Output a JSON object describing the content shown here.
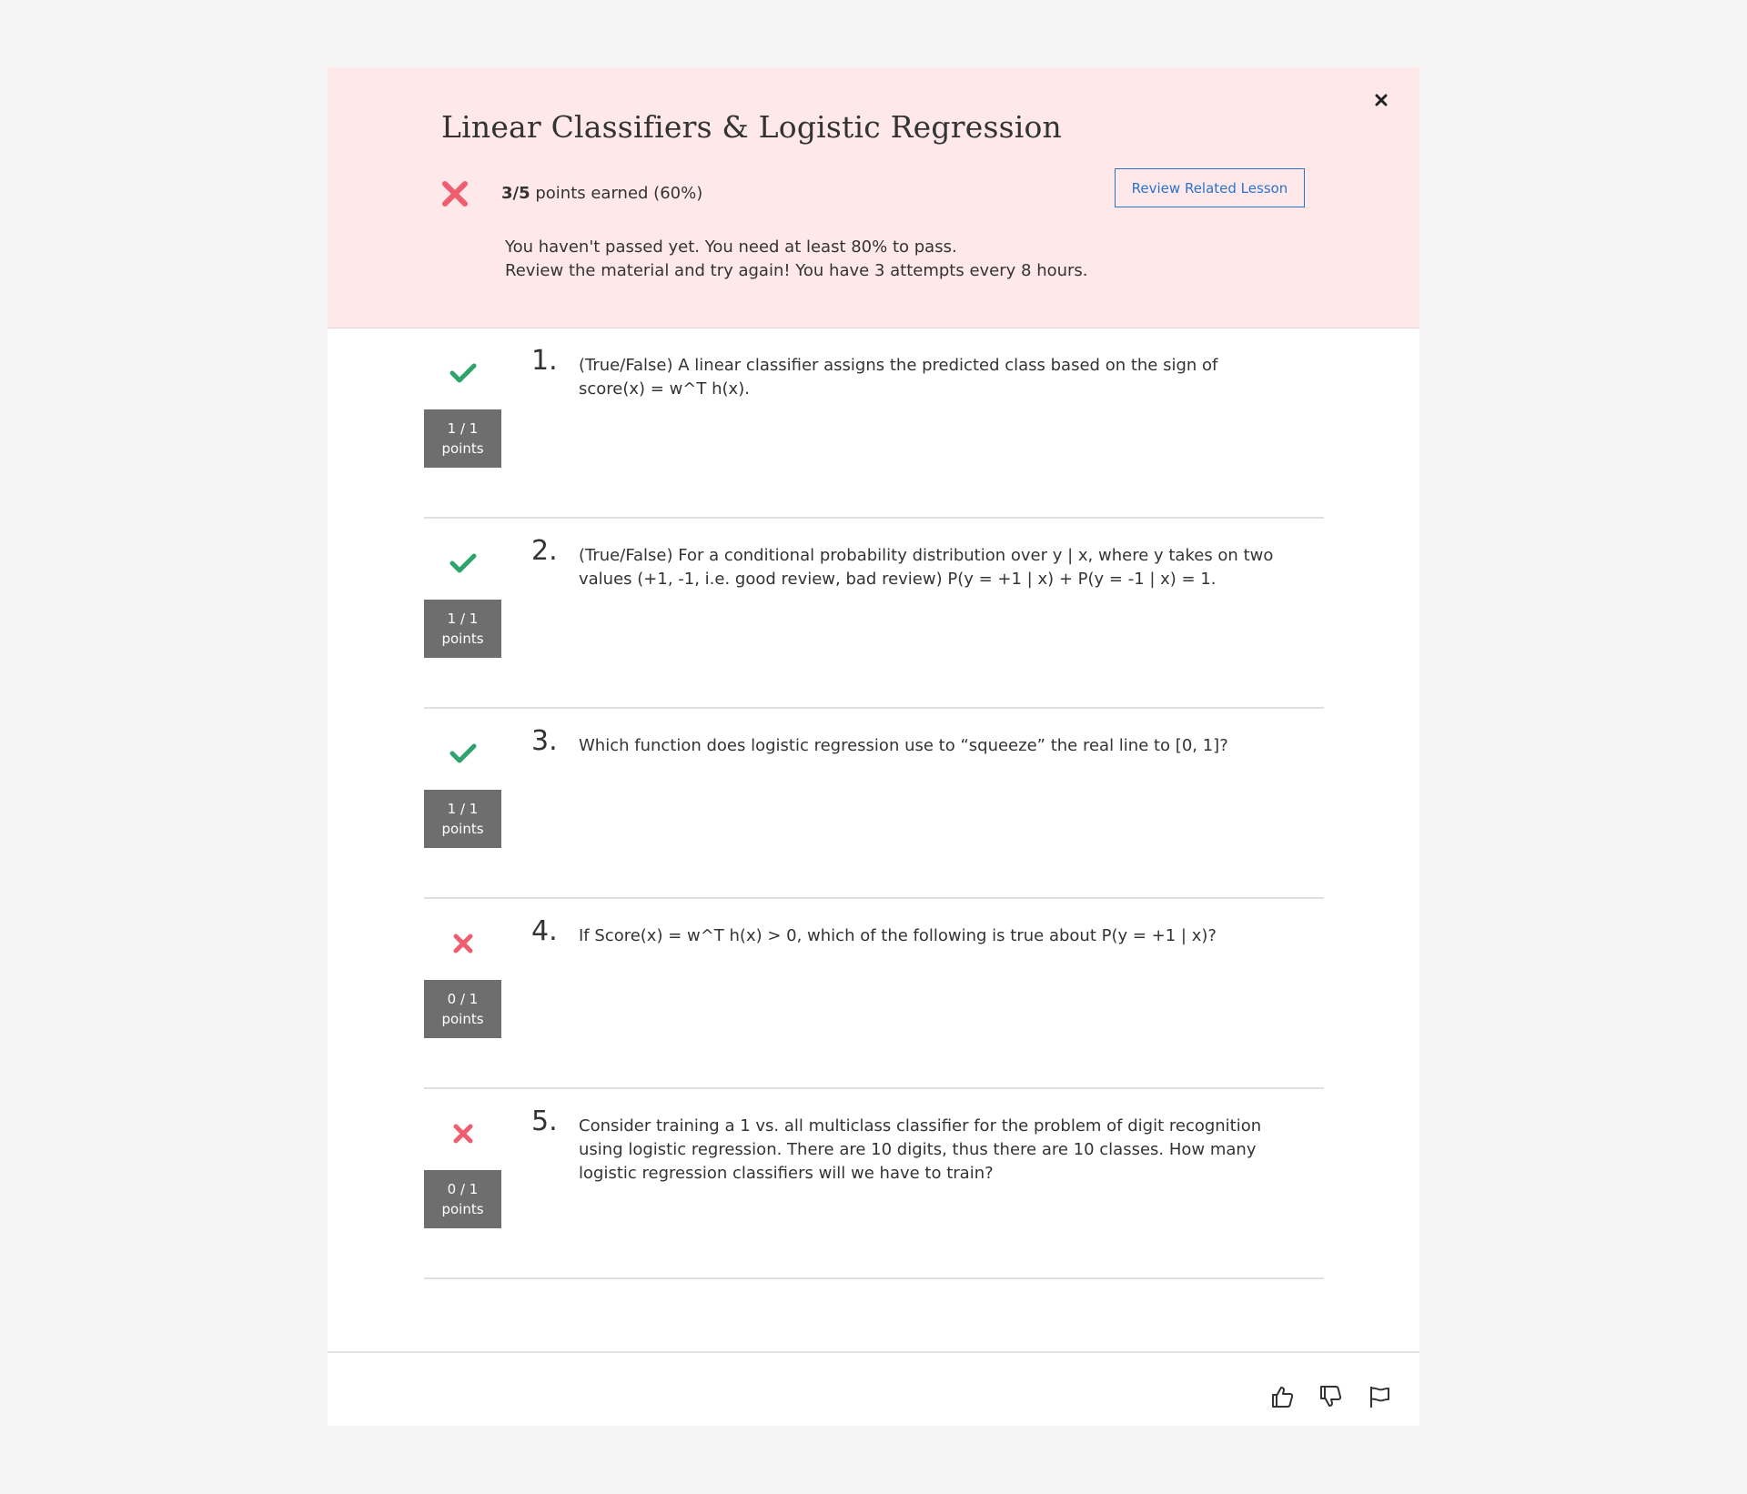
{
  "banner": {
    "title": "Linear Classifiers & Logistic Regression",
    "score_value": "3/5",
    "score_suffix": " points earned (60%)",
    "review_button_label": "Review Related Lesson",
    "message_line1": "You haven't passed yet. You need at least 80% to pass.",
    "message_line2": "Review the material and try again!  You have 3 attempts every 8 hours.",
    "close_icon": "close-icon",
    "result_icon": "fail-x-icon"
  },
  "questions": [
    {
      "number": "1.",
      "text": "(True/False) A linear classifier assigns the predicted class based on the sign of score(x) = w^T h(x).",
      "points": "1 / 1",
      "points_label": "points",
      "correct": true
    },
    {
      "number": "2.",
      "text": "(True/False) For a conditional probability distribution over y | x, where y takes on two values (+1, -1, i.e. good review, bad review) P(y = +1 | x) + P(y = -1 | x) = 1.",
      "points": "1 / 1",
      "points_label": "points",
      "correct": true
    },
    {
      "number": "3.",
      "text": "Which function does logistic regression use to “squeeze” the real line to [0, 1]?",
      "points": "1 / 1",
      "points_label": "points",
      "correct": true
    },
    {
      "number": "4.",
      "text": "If Score(x) = w^T h(x) > 0, which of the following is true about P(y = +1 | x)?",
      "points": "0 / 1",
      "points_label": "points",
      "correct": false
    },
    {
      "number": "5.",
      "text": "Consider training a 1 vs. all multiclass classifier for the problem of digit recognition using logistic regression. There are 10 digits, thus there are 10 classes. How many logistic regression classifiers will we have to train?",
      "points": "0 / 1",
      "points_label": "points",
      "correct": false
    }
  ],
  "footer": {
    "icons": [
      "thumbs-up-icon",
      "thumbs-down-icon",
      "flag-icon"
    ]
  },
  "colors": {
    "banner_bg": "#ffe8ea",
    "correct": "#2ea36b",
    "incorrect": "#f05d6e",
    "link": "#2a73cc",
    "points_bg": "#6e6e6e"
  }
}
